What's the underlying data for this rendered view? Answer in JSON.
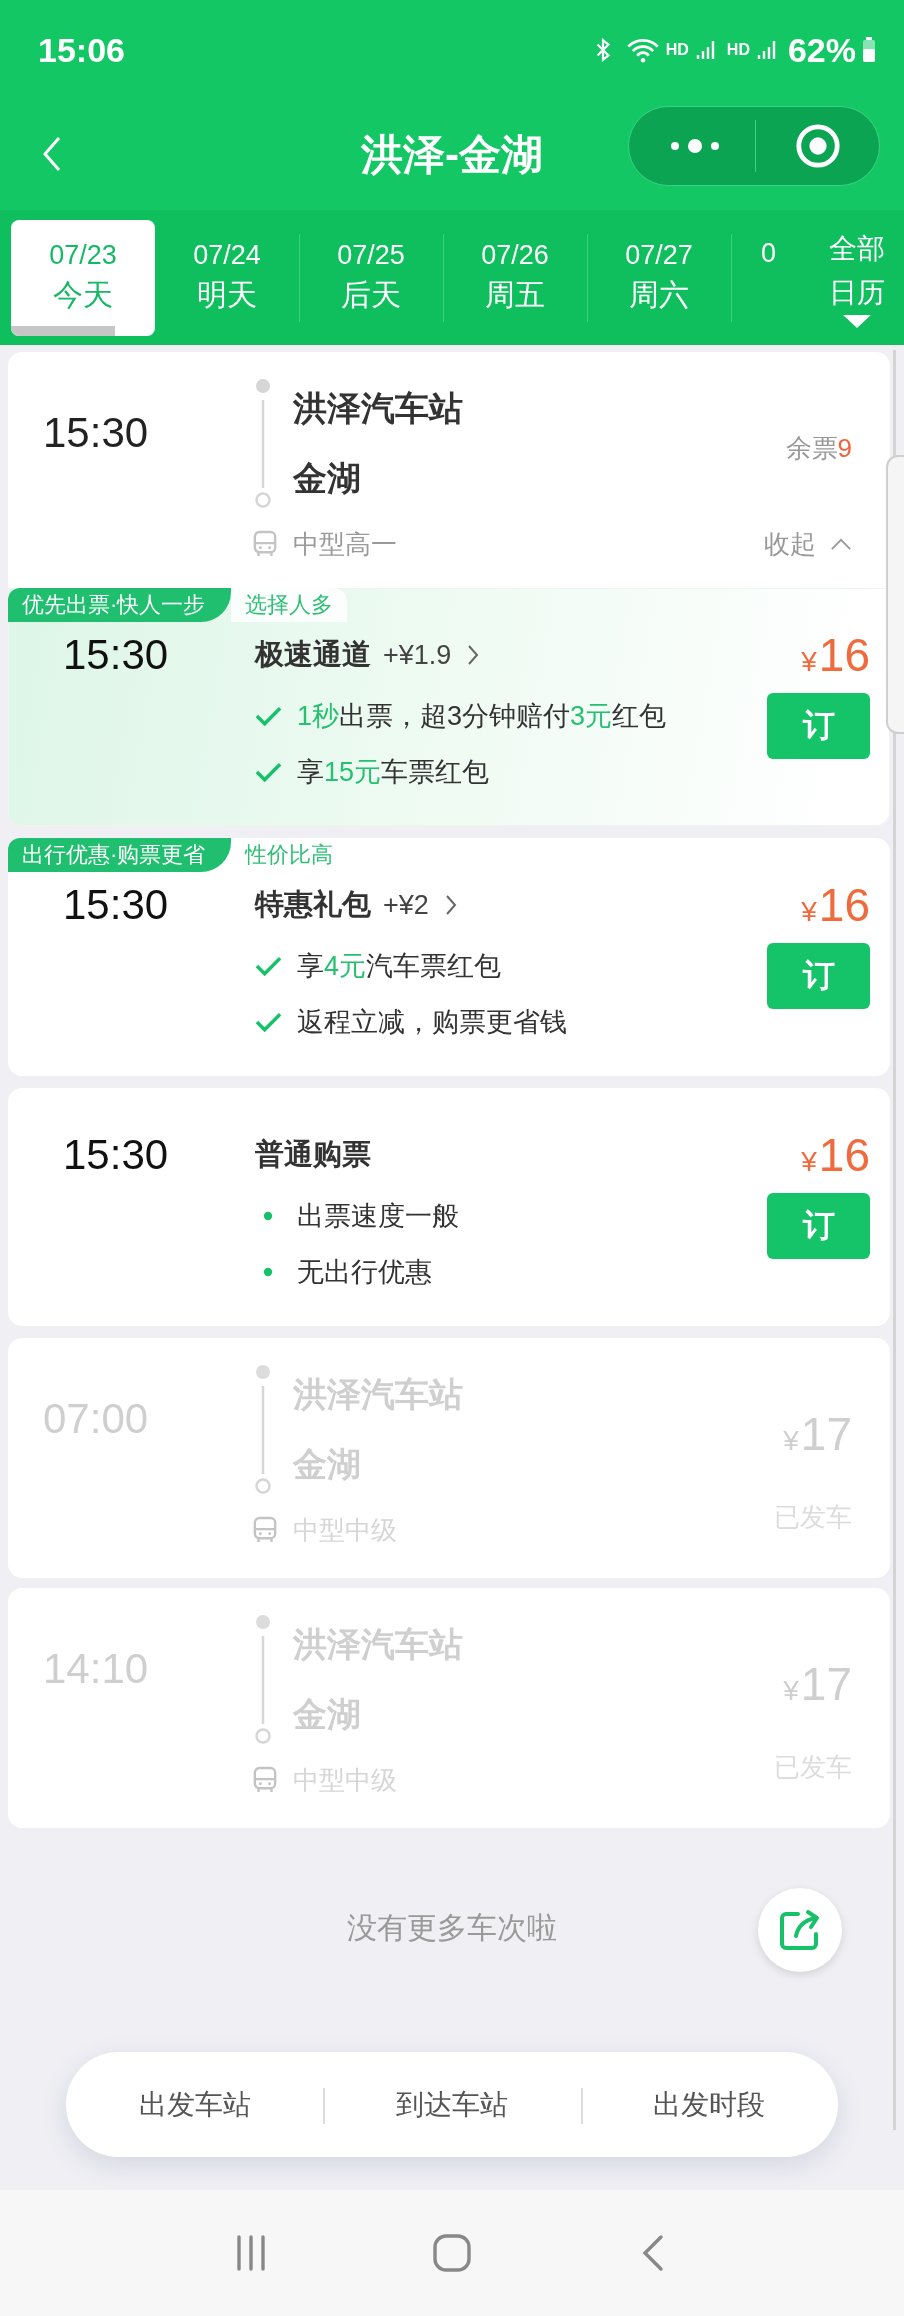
{
  "status_bar": {
    "time": "15:06",
    "network_1": "HD",
    "network_2": "HD",
    "battery": "62%"
  },
  "header": {
    "title": "洪泽-金湖"
  },
  "date_tabs": [
    {
      "date": "07/23",
      "day": "今天",
      "selected": true
    },
    {
      "date": "07/24",
      "day": "明天",
      "selected": false
    },
    {
      "date": "07/25",
      "day": "后天",
      "selected": false
    },
    {
      "date": "07/26",
      "day": "周五",
      "selected": false
    },
    {
      "date": "07/27",
      "day": "周六",
      "selected": false
    },
    {
      "date": "0",
      "selected": false
    }
  ],
  "calendar_button": {
    "line_1": "全部",
    "line_2": "日历"
  },
  "trips": [
    {
      "time": "15:30",
      "from": "洪泽汽车站",
      "to": "金湖",
      "bus_type": "中型高一",
      "departed": false,
      "remaining_label": "余票",
      "remaining_count": "9",
      "collapse_label": "收起",
      "options": [
        {
          "tag": "优先出票·快人一步",
          "tag_note": "选择人多",
          "featured": true,
          "time": "15:30",
          "name": "极速通道",
          "surcharge": "+¥1.9",
          "currency": "¥",
          "price": "16",
          "book_label": "订",
          "kind": "check",
          "features": [
            {
              "parts": [
                {
                  "text": "1秒",
                  "highlight": true
                },
                {
                  "text": "出票，超3分钟赔付",
                  "highlight": false
                },
                {
                  "text": "3元",
                  "highlight": true
                },
                {
                  "text": "红包",
                  "highlight": false
                }
              ]
            },
            {
              "parts": [
                {
                  "text": "享",
                  "highlight": false
                },
                {
                  "text": "15元",
                  "highlight": true
                },
                {
                  "text": "车票红包",
                  "highlight": false
                }
              ]
            }
          ]
        },
        {
          "tag": "出行优惠·购票更省",
          "tag_note": "性价比高",
          "featured": false,
          "time": "15:30",
          "name": "特惠礼包",
          "surcharge": "+¥2",
          "currency": "¥",
          "price": "16",
          "book_label": "订",
          "kind": "check",
          "features": [
            {
              "parts": [
                {
                  "text": "享",
                  "highlight": false
                },
                {
                  "text": "4元",
                  "highlight": true
                },
                {
                  "text": "汽车票红包",
                  "highlight": false
                }
              ]
            },
            {
              "parts": [
                {
                  "text": "返程立减，购票更省钱",
                  "highlight": false
                }
              ]
            }
          ]
        },
        {
          "featured": false,
          "time": "15:30",
          "name": "普通购票",
          "currency": "¥",
          "price": "16",
          "book_label": "订",
          "kind": "dot",
          "features": [
            {
              "parts": [
                {
                  "text": "出票速度一般",
                  "highlight": false
                }
              ]
            },
            {
              "parts": [
                {
                  "text": "无出行优惠",
                  "highlight": false
                }
              ]
            }
          ]
        }
      ]
    },
    {
      "time": "07:00",
      "from": "洪泽汽车站",
      "to": "金湖",
      "bus_type": "中型中级",
      "departed": true,
      "currency": "¥",
      "price": "17",
      "status": "已发车"
    },
    {
      "time": "14:10",
      "from": "洪泽汽车站",
      "to": "金湖",
      "bus_type": "中型中级",
      "departed": true,
      "currency": "¥",
      "price": "17",
      "status": "已发车"
    }
  ],
  "end_note": "没有更多车次啦",
  "filters": [
    {
      "label": "出发车站"
    },
    {
      "label": "到达车站"
    },
    {
      "label": "出发时段"
    }
  ]
}
